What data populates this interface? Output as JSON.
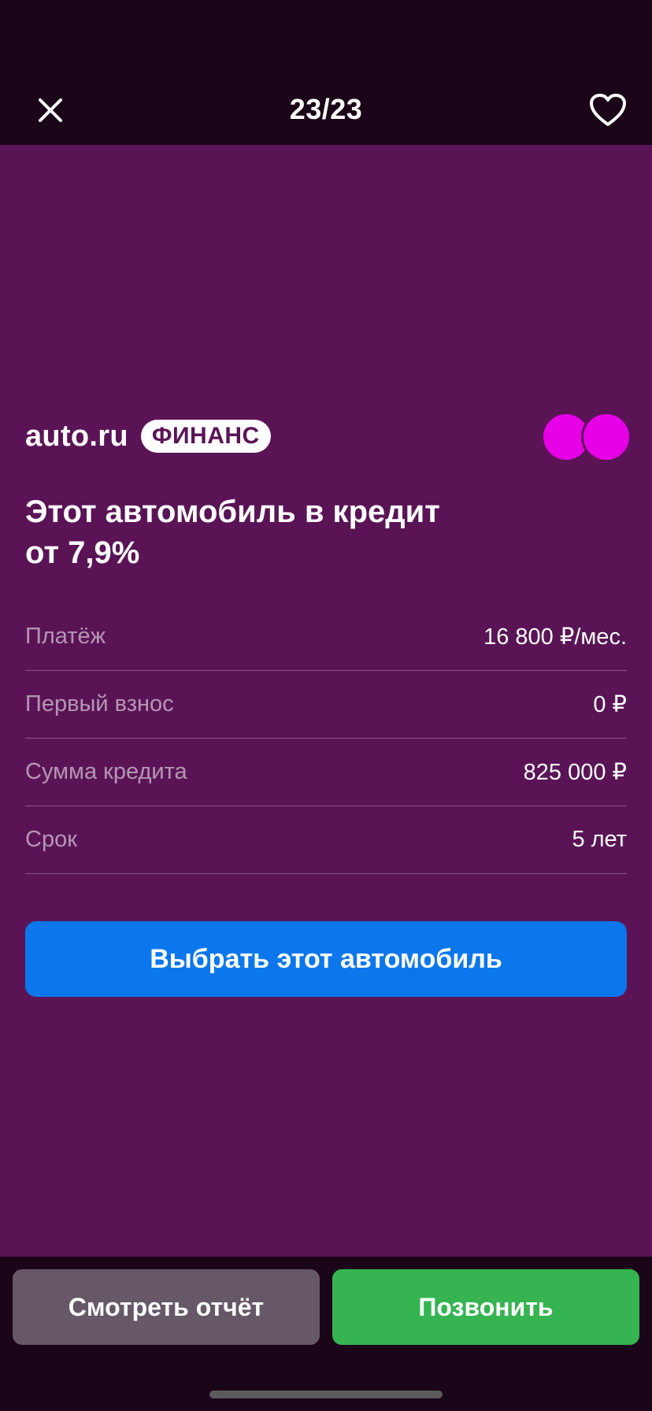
{
  "header": {
    "counter": "23/23",
    "close_icon": "close-icon",
    "favorite_icon": "heart-outline-icon"
  },
  "promo": {
    "brand_name": "auto.ru",
    "brand_badge": "ФИНАНС",
    "headline_line1": "Этот автомобиль в кредит",
    "headline_line2": "от 7,9%",
    "rows": [
      {
        "label": "Платёж",
        "value": "16 800 ₽/мес."
      },
      {
        "label": "Первый взнос",
        "value": "0 ₽"
      },
      {
        "label": "Сумма кредита",
        "value": "825 000 ₽"
      },
      {
        "label": "Срок",
        "value": "5 лет"
      }
    ],
    "select_button": "Выбрать этот автомобиль",
    "colors": {
      "panel_bg": "#5a1456",
      "accent_circles": "#e600e6",
      "primary_button": "#0c77ec"
    }
  },
  "footer": {
    "report_button": "Смотреть отчёт",
    "call_button": "Позвонить",
    "colors": {
      "report_button": "#665866",
      "call_button": "#35b451"
    }
  }
}
